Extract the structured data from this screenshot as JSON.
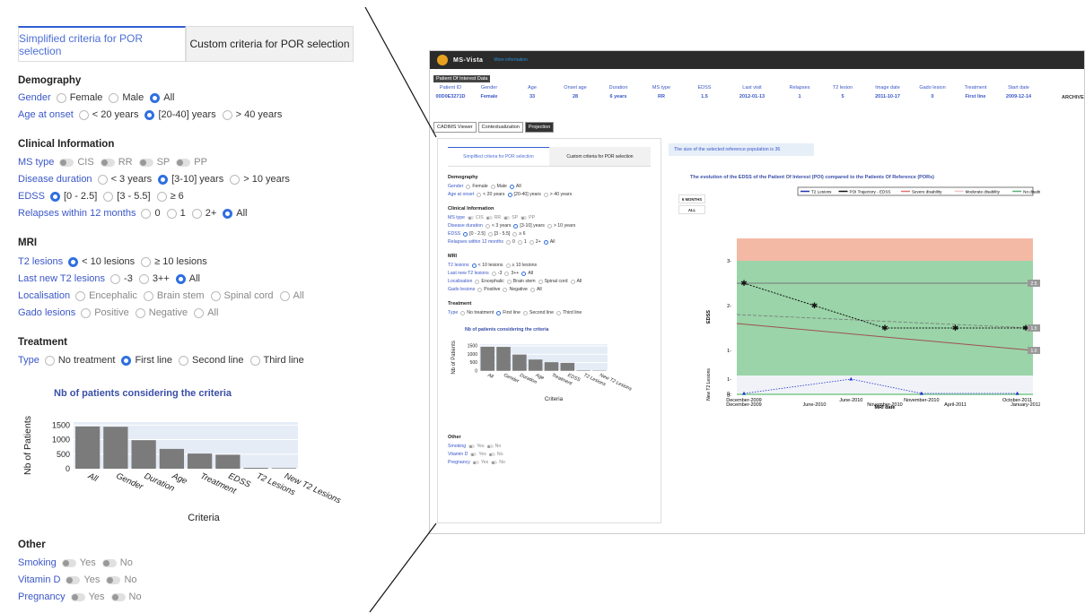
{
  "tabs": {
    "simplified": "Simplified criteria for POR selection",
    "custom": "Custom criteria for POR selection"
  },
  "demography": {
    "title": "Demography",
    "gender_label": "Gender",
    "gender_options": [
      "Female",
      "Male",
      "All"
    ],
    "age_label": "Age at onset",
    "age_options": [
      "< 20 years",
      "[20-40] years",
      "> 40 years"
    ]
  },
  "clinical": {
    "title": "Clinical Information",
    "ms_label": "MS type",
    "ms_options": [
      "CIS",
      "RR",
      "SP",
      "PP"
    ],
    "duration_label": "Disease duration",
    "duration_options": [
      "< 3 years",
      "[3-10] years",
      "> 10 years"
    ],
    "edss_label": "EDSS",
    "edss_options": [
      "[0 - 2.5]",
      "[3 - 5.5]",
      "≥ 6"
    ],
    "relapses_label": "Relapses within 12 months",
    "relapses_options": [
      "0",
      "1",
      "2+",
      "All"
    ]
  },
  "mri": {
    "title": "MRI",
    "t2_label": "T2 lesions",
    "t2_options": [
      "< 10 lesions",
      "≥ 10 lesions"
    ],
    "new_t2_label": "Last new T2 lesions",
    "new_t2_options": [
      "-3",
      "3++",
      "All"
    ],
    "loc_label": "Localisation",
    "loc_options": [
      "Encephalic",
      "Brain stem",
      "Spinal cord",
      "All"
    ],
    "gado_label": "Gado lesions",
    "gado_options": [
      "Positive",
      "Negative",
      "All"
    ]
  },
  "treatment": {
    "title": "Treatment",
    "type_label": "Type",
    "type_options": [
      "No treatment",
      "First line",
      "Second line",
      "Third line"
    ]
  },
  "other": {
    "title": "Other",
    "smoking_label": "Smoking",
    "vitd_label": "Vitamin D",
    "pregnancy_label": "Pregnancy",
    "yes": "Yes",
    "no": "No"
  },
  "app": {
    "name": "MS-Vista",
    "more_info": "More information",
    "patient_label": "Patient Of Interest Data",
    "archive": "ARCHIVE",
    "tabs": [
      "CADIMS Viewer",
      "Contextualization",
      "Projection"
    ],
    "reference_info": "The size of the selected reference population is 36"
  },
  "patient": {
    "headers": [
      "Patient ID",
      "Gender",
      "Age",
      "Onset age",
      "Duration",
      "MS type",
      "EDSS",
      "Last visit",
      "Relapses",
      "T2 lesion",
      "Image date",
      "Gado lesion",
      "Treatment",
      "Start date"
    ],
    "values": [
      "00D0E3271D",
      "Female",
      "33",
      "28",
      "6 years",
      "RR",
      "1.5",
      "2012-01-13",
      "1",
      "5",
      "2011-10-17",
      "0",
      "First line",
      "2009-12-14"
    ]
  },
  "colors": {
    "accent": "#2f6fe0",
    "label_blue": "#3a57c8",
    "bar": "#7b7b7b",
    "severe": "#f4b9a5",
    "moderate": "#f1d9c4",
    "none": "#8fcf9e"
  },
  "chart_data": [
    {
      "type": "bar",
      "title": "Nb of patients considering the criteria",
      "xlabel": "Criteria",
      "ylabel": "Nb of Patients",
      "categories": [
        "All",
        "Gender",
        "Duration",
        "Age",
        "Treatment",
        "EDSS",
        "T2 Lesions",
        "New T2 Lesions"
      ],
      "values": [
        1450,
        1440,
        980,
        680,
        520,
        480,
        30,
        20
      ],
      "ylim": [
        0,
        1600
      ],
      "yticks": [
        0,
        500,
        1000,
        1500
      ]
    },
    {
      "type": "line",
      "title": "The evolution of the EDSS of the Patient Of Interest (POI) compared to the Patients Of Reference (PORs)",
      "ylabel": "EDSS",
      "xlabel": "Visit date",
      "x_ticks": [
        "December-2009",
        "June-2010",
        "November-2010",
        "April-2011",
        "January-2012"
      ],
      "y_ticks": [
        "0",
        "1",
        "2",
        "3"
      ],
      "ylim": [
        0,
        3.5
      ],
      "range_buttons": [
        "6 MONTHS",
        "ALL"
      ],
      "legend": [
        "T2 Lesions",
        "POI Trajectory - EDSS",
        "Severe disability",
        "Moderate disability",
        "No disability"
      ],
      "series": [
        {
          "name": "POI Trajectory - EDSS",
          "x": [
            "December-2009",
            "June-2010",
            "November-2010",
            "April-2011",
            "January-2012"
          ],
          "values": [
            2.5,
            2.0,
            1.5,
            1.5,
            1.5
          ]
        }
      ],
      "ref_labels": [
        "2.5",
        "1.5",
        "1.0"
      ]
    },
    {
      "type": "line",
      "ylabel": "New T2 Lesions",
      "xlabel": "MRI date",
      "x_ticks": [
        "December-2009",
        "June-2010",
        "November-2010",
        "October-2011"
      ],
      "y_ticks": [
        "0",
        "1"
      ],
      "series": [
        {
          "name": "T2 Lesions",
          "values": [
            0,
            1,
            0,
            0
          ]
        }
      ]
    }
  ]
}
